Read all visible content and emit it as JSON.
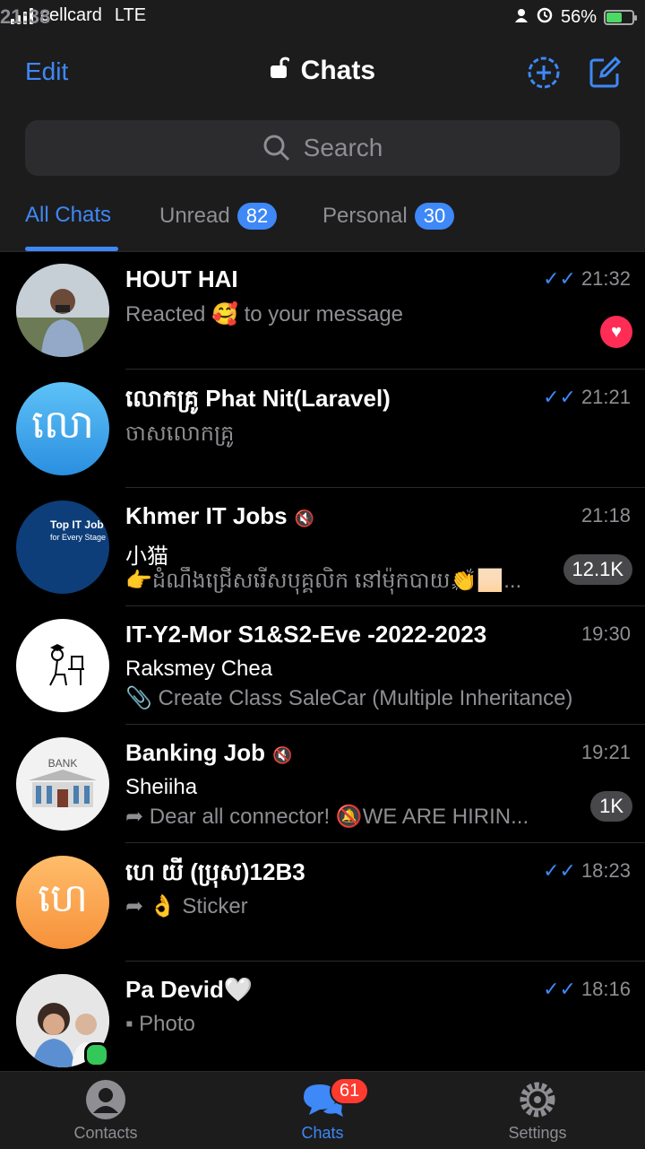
{
  "status_bar": {
    "carrier": "cellcard",
    "network": "LTE",
    "time": "21:38",
    "battery": "56%"
  },
  "header": {
    "edit_label": "Edit",
    "title": "Chats"
  },
  "search": {
    "placeholder": "Search"
  },
  "tabs": [
    {
      "label": "All Chats",
      "badge": ""
    },
    {
      "label": "Unread",
      "badge": "82"
    },
    {
      "label": "Personal",
      "badge": "30"
    }
  ],
  "chats": [
    {
      "name": "HOUT HAI",
      "time": "21:32",
      "read": "✓✓",
      "line1": "Reacted 🥰 to your message",
      "reaction": "♥"
    },
    {
      "name": "លោកគ្រូ Phat Nit(Laravel)",
      "time": "21:21",
      "read": "✓✓",
      "line1": "ចាសលោកគ្រូ",
      "avatar_text": "លោ"
    },
    {
      "name": "Khmer IT Jobs",
      "time": "21:18",
      "line1": "小猫",
      "line2": "👉ដំណឹងជ្រើសរើសបុគ្គលិក នៅម៉ុកបាយ👏🏻...",
      "count": "12.1K",
      "avatar_text": "Top IT Job",
      "avatar_sub": "for Every Stage"
    },
    {
      "name": "IT-Y2-Mor S1&S2-Eve -2022-2023",
      "time": "19:30",
      "line1": "Raksmey Chea",
      "line2": "📎 Create Class SaleCar (Multiple Inheritance)"
    },
    {
      "name": "Banking Job",
      "time": "19:21",
      "line1": "Sheiiha",
      "line2": "➦ Dear all connector! 🔕WE ARE HIRIN...",
      "count": "1K",
      "avatar_text": "BANK"
    },
    {
      "name": "ហេ យី (ប្រុស)12B3",
      "time": "18:23",
      "read": "✓✓",
      "line1": "➦ 👌 Sticker",
      "avatar_text": "ហេ"
    },
    {
      "name": "Pa Devid🤍",
      "time": "18:16",
      "read": "✓✓",
      "line1": "▪ Photo"
    }
  ],
  "tabbar": [
    {
      "label": "Contacts"
    },
    {
      "label": "Chats",
      "badge": "61"
    },
    {
      "label": "Settings"
    }
  ],
  "colors": {
    "accent": "#3e88f7",
    "background": "#000000",
    "panel": "#1c1c1d"
  }
}
